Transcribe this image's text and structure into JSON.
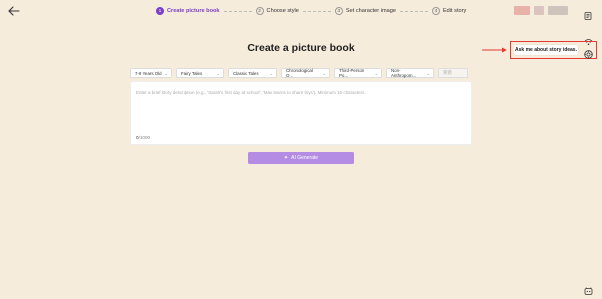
{
  "header": {
    "back_icon": "arrow-left-icon",
    "steps": [
      {
        "num": "1",
        "label": "Create picture book",
        "active": true
      },
      {
        "num": "2",
        "label": "Choose style",
        "active": false
      },
      {
        "num": "3",
        "label": "Set character image",
        "active": false
      },
      {
        "num": "4",
        "label": "Edit story",
        "active": false
      }
    ]
  },
  "page": {
    "title": "Create a picture book"
  },
  "filters": [
    {
      "label": "7-9 Years Old"
    },
    {
      "label": "Fairy Tales"
    },
    {
      "label": "Classic Tales"
    },
    {
      "label": "Chronological O..."
    },
    {
      "label": "Third-Person Po..."
    },
    {
      "label": "Non-Anthropom..."
    },
    {
      "label": "繁體"
    }
  ],
  "description": {
    "placeholder": "Enter a brief story description (e.g., 'Sarah's first day at school', 'Max learns to share toys'). Minimum 10 characters.",
    "count_current": "0",
    "count_max": "/1000"
  },
  "generate_button": {
    "label": "AI Generate"
  },
  "assistant": {
    "tooltip": "Ask me about story ideas."
  },
  "colors": {
    "accent": "#7b3fc9",
    "button": "#b48ce4",
    "background": "#f6ecdc",
    "highlight": "#e53935"
  }
}
